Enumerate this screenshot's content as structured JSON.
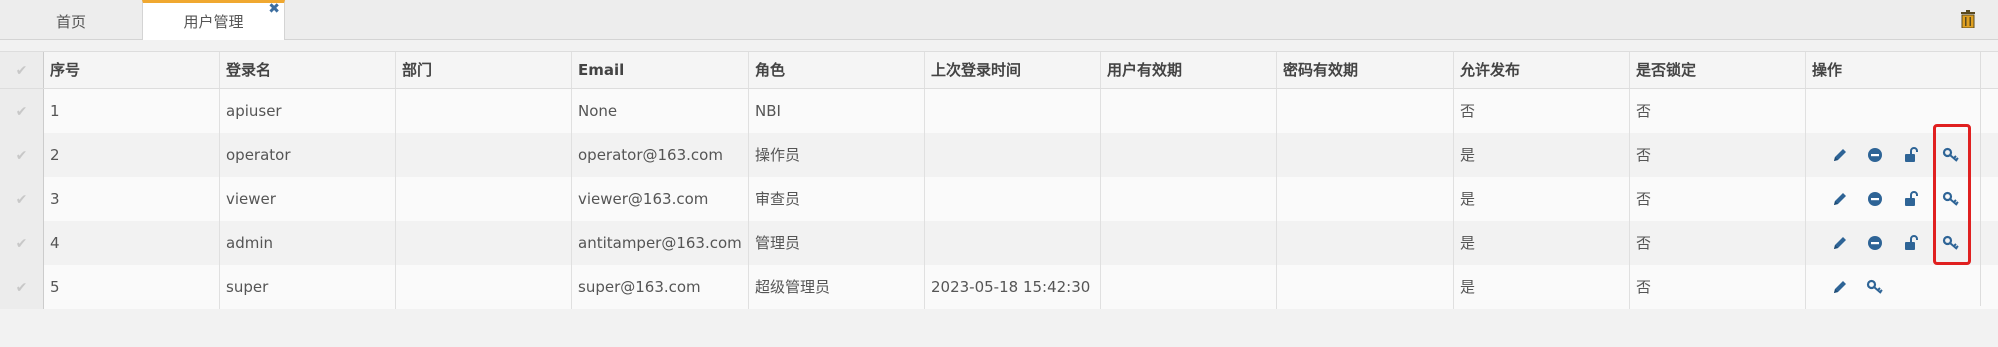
{
  "tabs": [
    {
      "label": "首页"
    },
    {
      "label": "用户管理",
      "close": "✖"
    }
  ],
  "table": {
    "headers": [
      "序号",
      "登录名",
      "部门",
      "Email",
      "角色",
      "上次登录时间",
      "用户有效期",
      "密码有效期",
      "允许发布",
      "是否锁定",
      "操作"
    ],
    "rows": [
      {
        "no": "1",
        "login": "apiuser",
        "dept": "",
        "email": "None",
        "role": "NBI",
        "last_login": "",
        "user_valid": "",
        "pwd_valid": "",
        "publish": "否",
        "locked": "否",
        "actions": []
      },
      {
        "no": "2",
        "login": "operator",
        "dept": "",
        "email": "operator@163.com",
        "role": "操作员",
        "last_login": "",
        "user_valid": "",
        "pwd_valid": "",
        "publish": "是",
        "locked": "否",
        "actions": [
          "edit-icon",
          "disable-icon",
          "unlock-icon",
          "key-icon"
        ]
      },
      {
        "no": "3",
        "login": "viewer",
        "dept": "",
        "email": "viewer@163.com",
        "role": "审查员",
        "last_login": "",
        "user_valid": "",
        "pwd_valid": "",
        "publish": "是",
        "locked": "否",
        "actions": [
          "edit-icon",
          "disable-icon",
          "unlock-icon",
          "key-icon"
        ]
      },
      {
        "no": "4",
        "login": "admin",
        "dept": "",
        "email": "antitamper@163.com",
        "role": "管理员",
        "last_login": "",
        "user_valid": "",
        "pwd_valid": "",
        "publish": "是",
        "locked": "否",
        "actions": [
          "edit-icon",
          "disable-icon",
          "unlock-icon",
          "key-icon"
        ]
      },
      {
        "no": "5",
        "login": "super",
        "dept": "",
        "email": "super@163.com",
        "role": "超级管理员",
        "last_login": "2023-05-18  15:42:30",
        "user_valid": "",
        "pwd_valid": "",
        "publish": "是",
        "locked": "否",
        "actions": [
          "edit-icon",
          "key-icon"
        ]
      }
    ]
  },
  "colors": {
    "accent_tab": "#f0a830",
    "icon_blue": "#2e6496",
    "highlight": "#e02020"
  }
}
